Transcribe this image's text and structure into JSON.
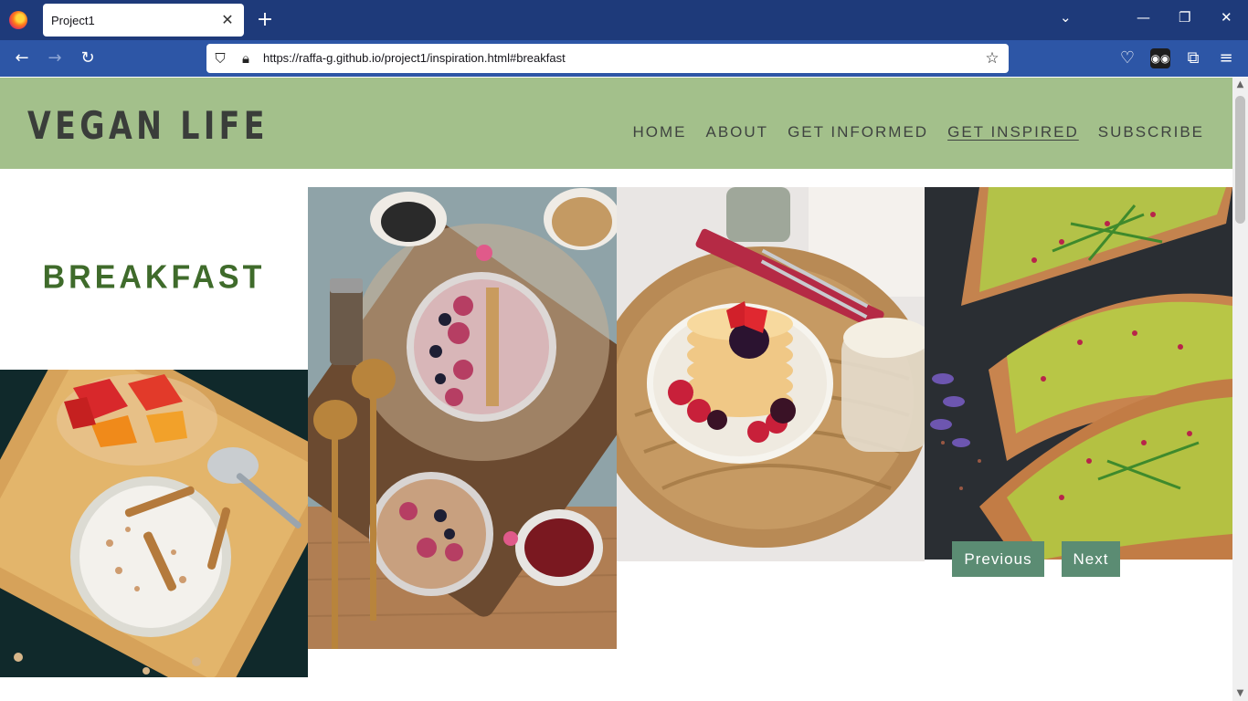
{
  "browser": {
    "tab_title": "Project1",
    "url": "https://raffa-g.github.io/project1/inspiration.html#breakfast",
    "icons": [
      "firefox-logo",
      "close-icon",
      "plus-icon",
      "chevron-down-icon",
      "minimize-icon",
      "restore-icon",
      "window-close-icon",
      "back-icon",
      "forward-icon",
      "reload-icon",
      "shield-icon",
      "lock-icon",
      "star-icon",
      "pocket-icon",
      "profile-icon",
      "extensions-icon",
      "menu-icon"
    ]
  },
  "site": {
    "logo": "VEGAN LIFE",
    "nav": [
      {
        "label": "HOME"
      },
      {
        "label": "ABOUT"
      },
      {
        "label": "GET INFORMED"
      },
      {
        "label": "GET INSPIRED",
        "active": true
      },
      {
        "label": "SUBSCRIBE"
      }
    ],
    "colors": {
      "header_bg": "#a3c08b",
      "title": "#3f6b2b",
      "button_bg": "#5b8c73"
    }
  },
  "section": {
    "title": "BREAKFAST"
  },
  "gallery": {
    "photos": [
      "porridge-with-fruit",
      "smoothie-bowls",
      "pancakes-with-berries",
      "avocado-toast"
    ]
  },
  "carousel": {
    "previous_label": "Previous",
    "next_label": "Next"
  }
}
